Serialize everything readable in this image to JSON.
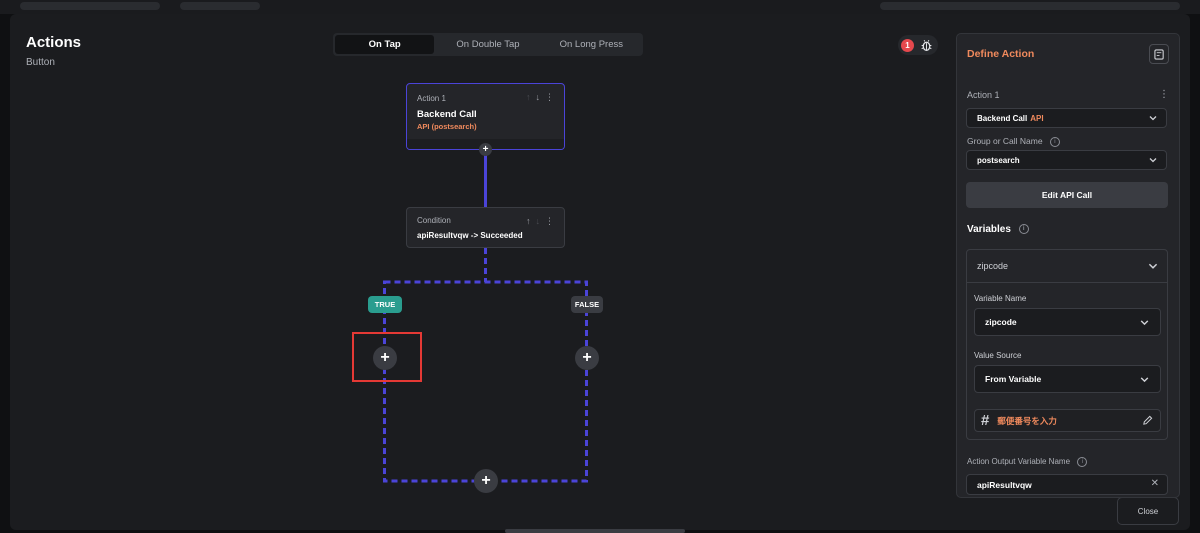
{
  "header": {
    "title": "Actions",
    "subtitle": "Button"
  },
  "tabs": [
    {
      "label": "On Tap",
      "active": true
    },
    {
      "label": "On Double Tap",
      "active": false
    },
    {
      "label": "On Long Press",
      "active": false
    }
  ],
  "debug": {
    "badge_count": "1",
    "icon": "bug-icon"
  },
  "flow": {
    "action1": {
      "label": "Action 1",
      "title": "Backend Call",
      "subtitle": "API (postsearch)"
    },
    "condition": {
      "label": "Condition",
      "title": "apiResultvqw -> Succeeded"
    },
    "branches": {
      "true_label": "TRUE",
      "false_label": "FALSE"
    },
    "add_symbol": "+"
  },
  "panel": {
    "title": "Define Action",
    "action_label": "Action 1",
    "action_type": {
      "value": "Backend Call",
      "accent": "API"
    },
    "group_label": "Group or Call Name",
    "group_value": "postsearch",
    "edit_button": "Edit API Call",
    "variables_title": "Variables",
    "variable": {
      "name_header": "zipcode",
      "variable_name_label": "Variable Name",
      "variable_name_value": "zipcode",
      "value_source_label": "Value Source",
      "value_source_value": "From Variable",
      "input_text": "郵便番号を入力"
    },
    "output_label": "Action Output Variable Name",
    "output_value": "apiResultvqw",
    "close_label": "Close"
  },
  "colors": {
    "accent": "#f08a5d",
    "flow_line": "#4b44d8",
    "true_pill": "#2a9d8f",
    "highlight": "#e53935",
    "badge": "#e5484d"
  }
}
